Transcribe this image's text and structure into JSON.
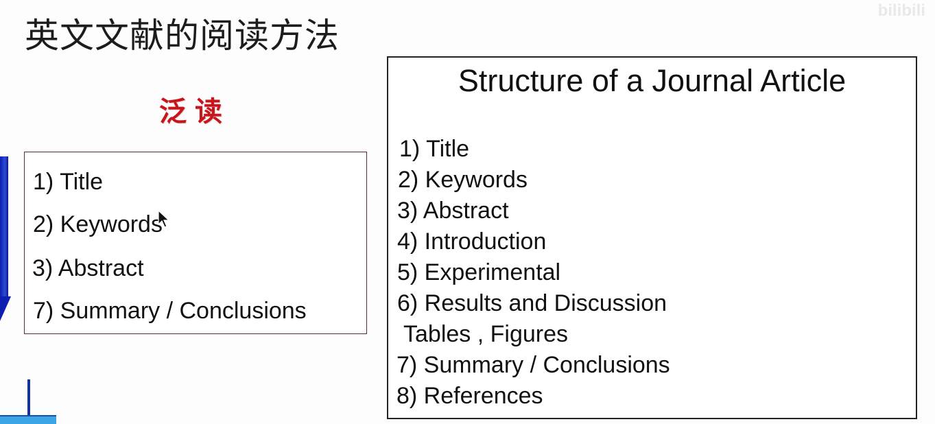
{
  "slide": {
    "title": "英文文献的阅读方法",
    "watermark": "bilibili",
    "skim_heading": "泛读"
  },
  "skim_list": {
    "items": [
      "1) Title",
      "2) Keywords",
      "3) Abstract",
      "7) Summary / Conclusions"
    ]
  },
  "structure_panel": {
    "title": "Structure of a Journal Article",
    "items": [
      "1) Title",
      "2) Keywords",
      "3) Abstract",
      "4) Introduction",
      "5) Experimental",
      "6) Results and Discussion",
      "Tables , Figures",
      "7) Summary / Conclusions",
      "8) References"
    ]
  },
  "colors": {
    "skim_heading": "#c8141a",
    "arrow": "#0d1fb0",
    "cross_bar": "#3aa4e4"
  },
  "icons": {
    "cursor": "mouse-pointer-icon",
    "arrow": "down-arrow-icon"
  }
}
